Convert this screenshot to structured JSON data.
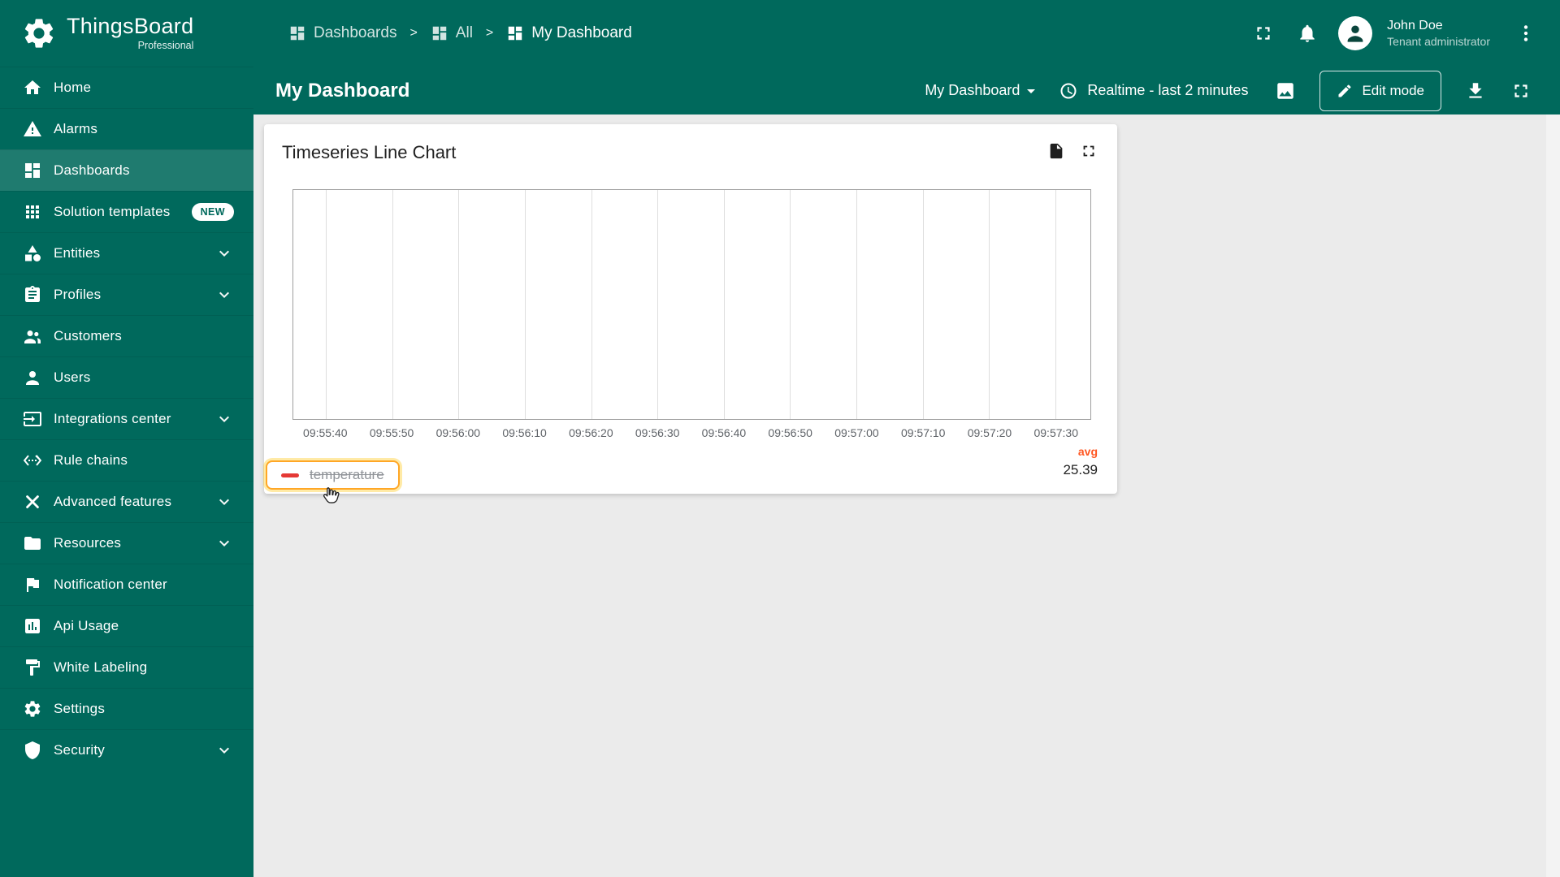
{
  "app": {
    "name": "ThingsBoard",
    "edition": "Professional"
  },
  "sidebar": {
    "items": [
      {
        "label": "Home",
        "icon": "home",
        "active": false,
        "chevron": false,
        "badge": null
      },
      {
        "label": "Alarms",
        "icon": "alarms",
        "active": false,
        "chevron": false,
        "badge": null
      },
      {
        "label": "Dashboards",
        "icon": "dashboards",
        "active": true,
        "chevron": false,
        "badge": null
      },
      {
        "label": "Solution templates",
        "icon": "solution-templates",
        "active": false,
        "chevron": false,
        "badge": "NEW"
      },
      {
        "label": "Entities",
        "icon": "entities",
        "active": false,
        "chevron": true,
        "badge": null
      },
      {
        "label": "Profiles",
        "icon": "profiles",
        "active": false,
        "chevron": true,
        "badge": null
      },
      {
        "label": "Customers",
        "icon": "customers",
        "active": false,
        "chevron": false,
        "badge": null
      },
      {
        "label": "Users",
        "icon": "users",
        "active": false,
        "chevron": false,
        "badge": null
      },
      {
        "label": "Integrations center",
        "icon": "integrations-center",
        "active": false,
        "chevron": true,
        "badge": null
      },
      {
        "label": "Rule chains",
        "icon": "rule-chains",
        "active": false,
        "chevron": false,
        "badge": null
      },
      {
        "label": "Advanced features",
        "icon": "advanced-features",
        "active": false,
        "chevron": true,
        "badge": null
      },
      {
        "label": "Resources",
        "icon": "resources",
        "active": false,
        "chevron": true,
        "badge": null
      },
      {
        "label": "Notification center",
        "icon": "notification-center",
        "active": false,
        "chevron": false,
        "badge": null
      },
      {
        "label": "Api Usage",
        "icon": "api-usage",
        "active": false,
        "chevron": false,
        "badge": null
      },
      {
        "label": "White Labeling",
        "icon": "white-labeling",
        "active": false,
        "chevron": false,
        "badge": null
      },
      {
        "label": "Settings",
        "icon": "settings",
        "active": false,
        "chevron": false,
        "badge": null
      },
      {
        "label": "Security",
        "icon": "security",
        "active": false,
        "chevron": true,
        "badge": null
      }
    ]
  },
  "header": {
    "breadcrumb": [
      "Dashboards",
      "All",
      "My Dashboard"
    ],
    "breadcrumb_separator": ">",
    "user": {
      "name": "John Doe",
      "role": "Tenant administrator"
    }
  },
  "toolbar": {
    "title": "My Dashboard",
    "dashboard_select": "My Dashboard",
    "time_window": "Realtime - last 2 minutes",
    "edit_button": "Edit mode"
  },
  "widget": {
    "title": "Timeseries Line Chart",
    "legend": {
      "label": "temperature",
      "hidden": true
    },
    "aggregation": {
      "label": "avg",
      "value": "25.39"
    }
  },
  "chart_data": {
    "type": "line",
    "title": "Timeseries Line Chart",
    "x_ticks": [
      "09:55:40",
      "09:55:50",
      "09:56:00",
      "09:56:10",
      "09:56:20",
      "09:56:30",
      "09:56:40",
      "09:56:50",
      "09:57:00",
      "09:57:10",
      "09:57:20",
      "09:57:30"
    ],
    "series": [
      {
        "name": "temperature",
        "color": "#e53935",
        "hidden": true,
        "avg": 25.39,
        "values": []
      }
    ],
    "legend_position": "bottom-left",
    "grid": "vertical-only",
    "ylim": null
  },
  "colors": {
    "primary_teal": "#00695c",
    "series_red": "#e53935",
    "avg_orange": "#ff5722",
    "focus_ring": "#ffa726",
    "content_bg": "#ebebeb"
  }
}
